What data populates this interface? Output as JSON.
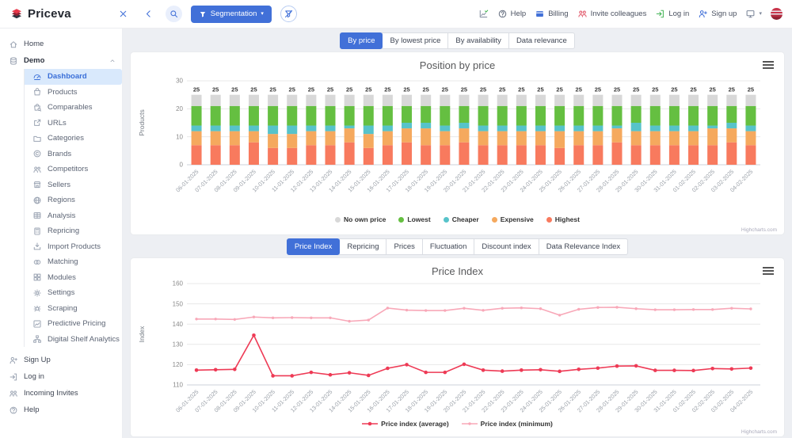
{
  "topbar": {
    "brand": "Priceva",
    "left_icons": [
      {
        "icon": "close",
        "color": "#4170d8"
      },
      {
        "icon": "chevron-left",
        "color": "#4170d8"
      },
      {
        "icon": "search",
        "color": "#4170d8",
        "circle": "fill"
      },
      {
        "icon": "funnel-off",
        "color": "#4170d8",
        "circle": "outline"
      }
    ],
    "segmentation_label": "Segmentation",
    "right_items": [
      {
        "icon": "chart-check",
        "label": "",
        "color": "#8a93a5"
      },
      {
        "icon": "help",
        "label": "Help",
        "color": "#6a7383"
      },
      {
        "icon": "billing",
        "label": "Billing",
        "color": "#4170d8"
      },
      {
        "icon": "invite",
        "label": "Invite colleagues",
        "color": "#e25b6d"
      },
      {
        "icon": "login",
        "label": "Log in",
        "color": "#46b558"
      },
      {
        "icon": "signup",
        "label": "Sign up",
        "color": "#4170d8"
      },
      {
        "icon": "monitor",
        "label": "",
        "color": "#7c8699",
        "caret": true
      },
      {
        "icon": "flag",
        "label": "",
        "avatar": true
      }
    ]
  },
  "sidebar": {
    "items": [
      {
        "label": "Home",
        "icon": "home"
      },
      {
        "label": "Demo",
        "icon": "database",
        "expanded": true,
        "bold": true,
        "children": [
          {
            "label": "Dashboard",
            "icon": "dashboard",
            "active": true
          },
          {
            "label": "Products",
            "icon": "bag"
          },
          {
            "label": "Comparables",
            "icon": "bag-search"
          },
          {
            "label": "URLs",
            "icon": "external"
          },
          {
            "label": "Categories",
            "icon": "folder"
          },
          {
            "label": "Brands",
            "icon": "copyright"
          },
          {
            "label": "Competitors",
            "icon": "people"
          },
          {
            "label": "Sellers",
            "icon": "store"
          },
          {
            "label": "Regions",
            "icon": "globe"
          },
          {
            "label": "Analysis",
            "icon": "table"
          },
          {
            "label": "Repricing",
            "icon": "calculator"
          },
          {
            "label": "Import Products",
            "icon": "import"
          },
          {
            "label": "Matching",
            "icon": "match"
          },
          {
            "label": "Modules",
            "icon": "modules"
          },
          {
            "label": "Settings",
            "icon": "gear"
          },
          {
            "label": "Scraping",
            "icon": "spider"
          },
          {
            "label": "Predictive Pricing",
            "icon": "chart-line"
          },
          {
            "label": "Digital Shelf Analytics",
            "icon": "sitemap"
          }
        ]
      }
    ],
    "footer": [
      {
        "label": "Sign Up",
        "icon": "signup",
        "color": "#e9768a"
      },
      {
        "label": "Log in",
        "icon": "login",
        "color": "#46b558"
      },
      {
        "label": "Incoming Invites",
        "icon": "invite",
        "color": "#8a93a5"
      },
      {
        "label": "Help",
        "icon": "help",
        "color": "#8a93a5"
      }
    ]
  },
  "tabs_position": {
    "items": [
      "By price",
      "By lowest price",
      "By availability",
      "Data relevance"
    ],
    "active": "By price"
  },
  "tabs_index": {
    "items": [
      "Price Index",
      "Repricing",
      "Prices",
      "Fluctuation",
      "Discount index",
      "Data Relevance Index"
    ],
    "active": "Price Index"
  },
  "credits": "Highcharts.com",
  "chart_data": [
    {
      "type": "bar",
      "stacked": true,
      "title": "Position by price",
      "ylabel": "Products",
      "ylim": [
        0,
        30
      ],
      "yticks": [
        0,
        10,
        20,
        30
      ],
      "bar_total_label": 25,
      "categories": [
        "06-01-2025",
        "07-01-2025",
        "08-01-2025",
        "09-01-2025",
        "10-01-2025",
        "11-01-2025",
        "12-01-2025",
        "13-01-2025",
        "14-01-2025",
        "15-01-2025",
        "16-01-2025",
        "17-01-2025",
        "18-01-2025",
        "19-01-2025",
        "20-01-2025",
        "21-01-2025",
        "22-01-2025",
        "23-01-2025",
        "24-01-2025",
        "25-01-2025",
        "26-01-2025",
        "27-01-2025",
        "28-01-2025",
        "29-01-2025",
        "30-01-2025",
        "31-01-2025",
        "01-02-2025",
        "02-02-2025",
        "03-02-2025",
        "04-02-2025"
      ],
      "stack_order_bottom_to_top": [
        "Highest",
        "Expensive",
        "Cheaper",
        "Lowest",
        "No own price"
      ],
      "series": [
        {
          "name": "No own price",
          "color": "#d8d8d8",
          "values": [
            4,
            4,
            4,
            4,
            4,
            4,
            4,
            4,
            4,
            4,
            4,
            4,
            4,
            4,
            4,
            4,
            4,
            4,
            4,
            4,
            4,
            4,
            4,
            4,
            4,
            4,
            4,
            4,
            4,
            4
          ]
        },
        {
          "name": "Lowest",
          "color": "#65bf41",
          "values": [
            7,
            7,
            7,
            7,
            7,
            7,
            7,
            7,
            7,
            7,
            7,
            6,
            6,
            7,
            6,
            7,
            7,
            7,
            7,
            7,
            7,
            7,
            7,
            6,
            7,
            7,
            7,
            7,
            6,
            7
          ]
        },
        {
          "name": "Cheaper",
          "color": "#57c3ca",
          "values": [
            2,
            2,
            2,
            2,
            3,
            3,
            2,
            2,
            1,
            3,
            2,
            2,
            2,
            2,
            2,
            2,
            2,
            2,
            2,
            2,
            2,
            2,
            1,
            3,
            2,
            2,
            2,
            1,
            2,
            2
          ]
        },
        {
          "name": "Expensive",
          "color": "#f5a95e",
          "values": [
            5,
            5,
            5,
            4,
            5,
            5,
            5,
            5,
            5,
            5,
            5,
            5,
            6,
            5,
            5,
            5,
            5,
            5,
            5,
            6,
            5,
            5,
            5,
            5,
            5,
            5,
            5,
            6,
            5,
            5
          ]
        },
        {
          "name": "Highest",
          "color": "#f87a5e",
          "values": [
            7,
            7,
            7,
            8,
            6,
            6,
            7,
            7,
            8,
            6,
            7,
            8,
            7,
            7,
            8,
            7,
            7,
            7,
            7,
            6,
            7,
            7,
            8,
            7,
            7,
            7,
            7,
            7,
            8,
            7
          ]
        }
      ],
      "legend_position": "bottom"
    },
    {
      "type": "line",
      "title": "Price Index",
      "ylabel": "Index",
      "ylim": [
        110,
        160
      ],
      "yticks": [
        110,
        120,
        130,
        140,
        150,
        160
      ],
      "categories": [
        "06-01-2025",
        "07-01-2025",
        "08-01-2025",
        "09-01-2025",
        "10-01-2025",
        "11-01-2025",
        "12-01-2025",
        "13-01-2025",
        "14-01-2025",
        "15-01-2025",
        "16-01-2025",
        "17-01-2025",
        "18-01-2025",
        "19-01-2025",
        "20-01-2025",
        "21-01-2025",
        "22-01-2025",
        "23-01-2025",
        "24-01-2025",
        "25-01-2025",
        "26-01-2025",
        "27-01-2025",
        "28-01-2025",
        "29-01-2025",
        "30-01-2025",
        "31-01-2025",
        "01-02-2025",
        "02-02-2025",
        "03-02-2025",
        "04-02-2025"
      ],
      "series": [
        {
          "name": "Price index (average)",
          "color": "#ee3a55",
          "marker_r": 2.3,
          "values": [
            117.3,
            117.5,
            117.7,
            134.5,
            114.5,
            114.5,
            116.2,
            115,
            116,
            114.7,
            118.2,
            120,
            116.2,
            116.2,
            120.2,
            117.3,
            116.8,
            117.3,
            117.5,
            116.7,
            117.7,
            118.3,
            119.3,
            119.4,
            117.2,
            117.2,
            117.1,
            118.1,
            117.9,
            118.3
          ]
        },
        {
          "name": "Price index (minimum)",
          "color": "#f8a8b8",
          "marker_r": 1.7,
          "values": [
            142.5,
            142.5,
            142.3,
            143.5,
            143.1,
            143.2,
            143.1,
            143.1,
            141.4,
            142,
            147.9,
            146.9,
            146.7,
            146.7,
            147.8,
            146.8,
            147.8,
            148,
            147.6,
            144.4,
            147.3,
            148.2,
            148.3,
            147.6,
            147.1,
            147.1,
            147.2,
            147.2,
            147.8,
            147.5
          ]
        }
      ],
      "legend_position": "bottom"
    }
  ]
}
